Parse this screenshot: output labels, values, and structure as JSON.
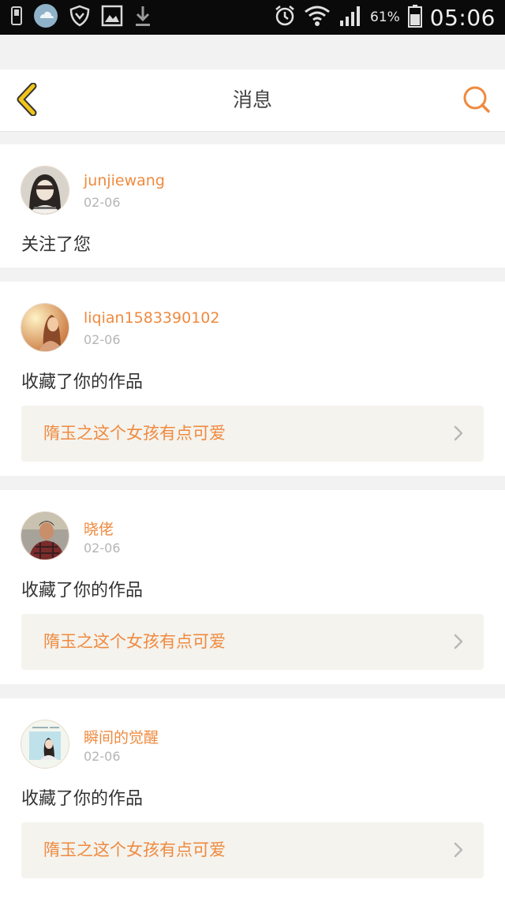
{
  "status_bar": {
    "battery_percent": "61%",
    "time": "05:06",
    "icons": [
      "sim-icon",
      "weather-icon",
      "shield-icon",
      "gallery-icon",
      "download-icon",
      "alarm-icon",
      "wifi-icon",
      "signal-icon",
      "battery-icon"
    ]
  },
  "header": {
    "title": "消息",
    "back_icon": "chevron-left-icon",
    "search_icon": "search-icon"
  },
  "colors": {
    "accent": "#ef8a3f",
    "back_icon": "#f0c419",
    "date": "#b5b5b5",
    "card_bg": "#ffffff",
    "page_bg": "#f2f2f2",
    "work_bg": "#f4f3ee"
  },
  "messages": [
    {
      "username": "junjiewang",
      "date": "02-06",
      "action": "关注了您"
    },
    {
      "username": "liqian1583390102",
      "date": "02-06",
      "action": "收藏了你的作品",
      "work_title": "隋玉之这个女孩有点可爱"
    },
    {
      "username": "晓佬",
      "date": "02-06",
      "action": "收藏了你的作品",
      "work_title": "隋玉之这个女孩有点可爱"
    },
    {
      "username": "瞬间的觉醒",
      "date": "02-06",
      "action": "收藏了你的作品",
      "work_title": "隋玉之这个女孩有点可爱"
    }
  ]
}
